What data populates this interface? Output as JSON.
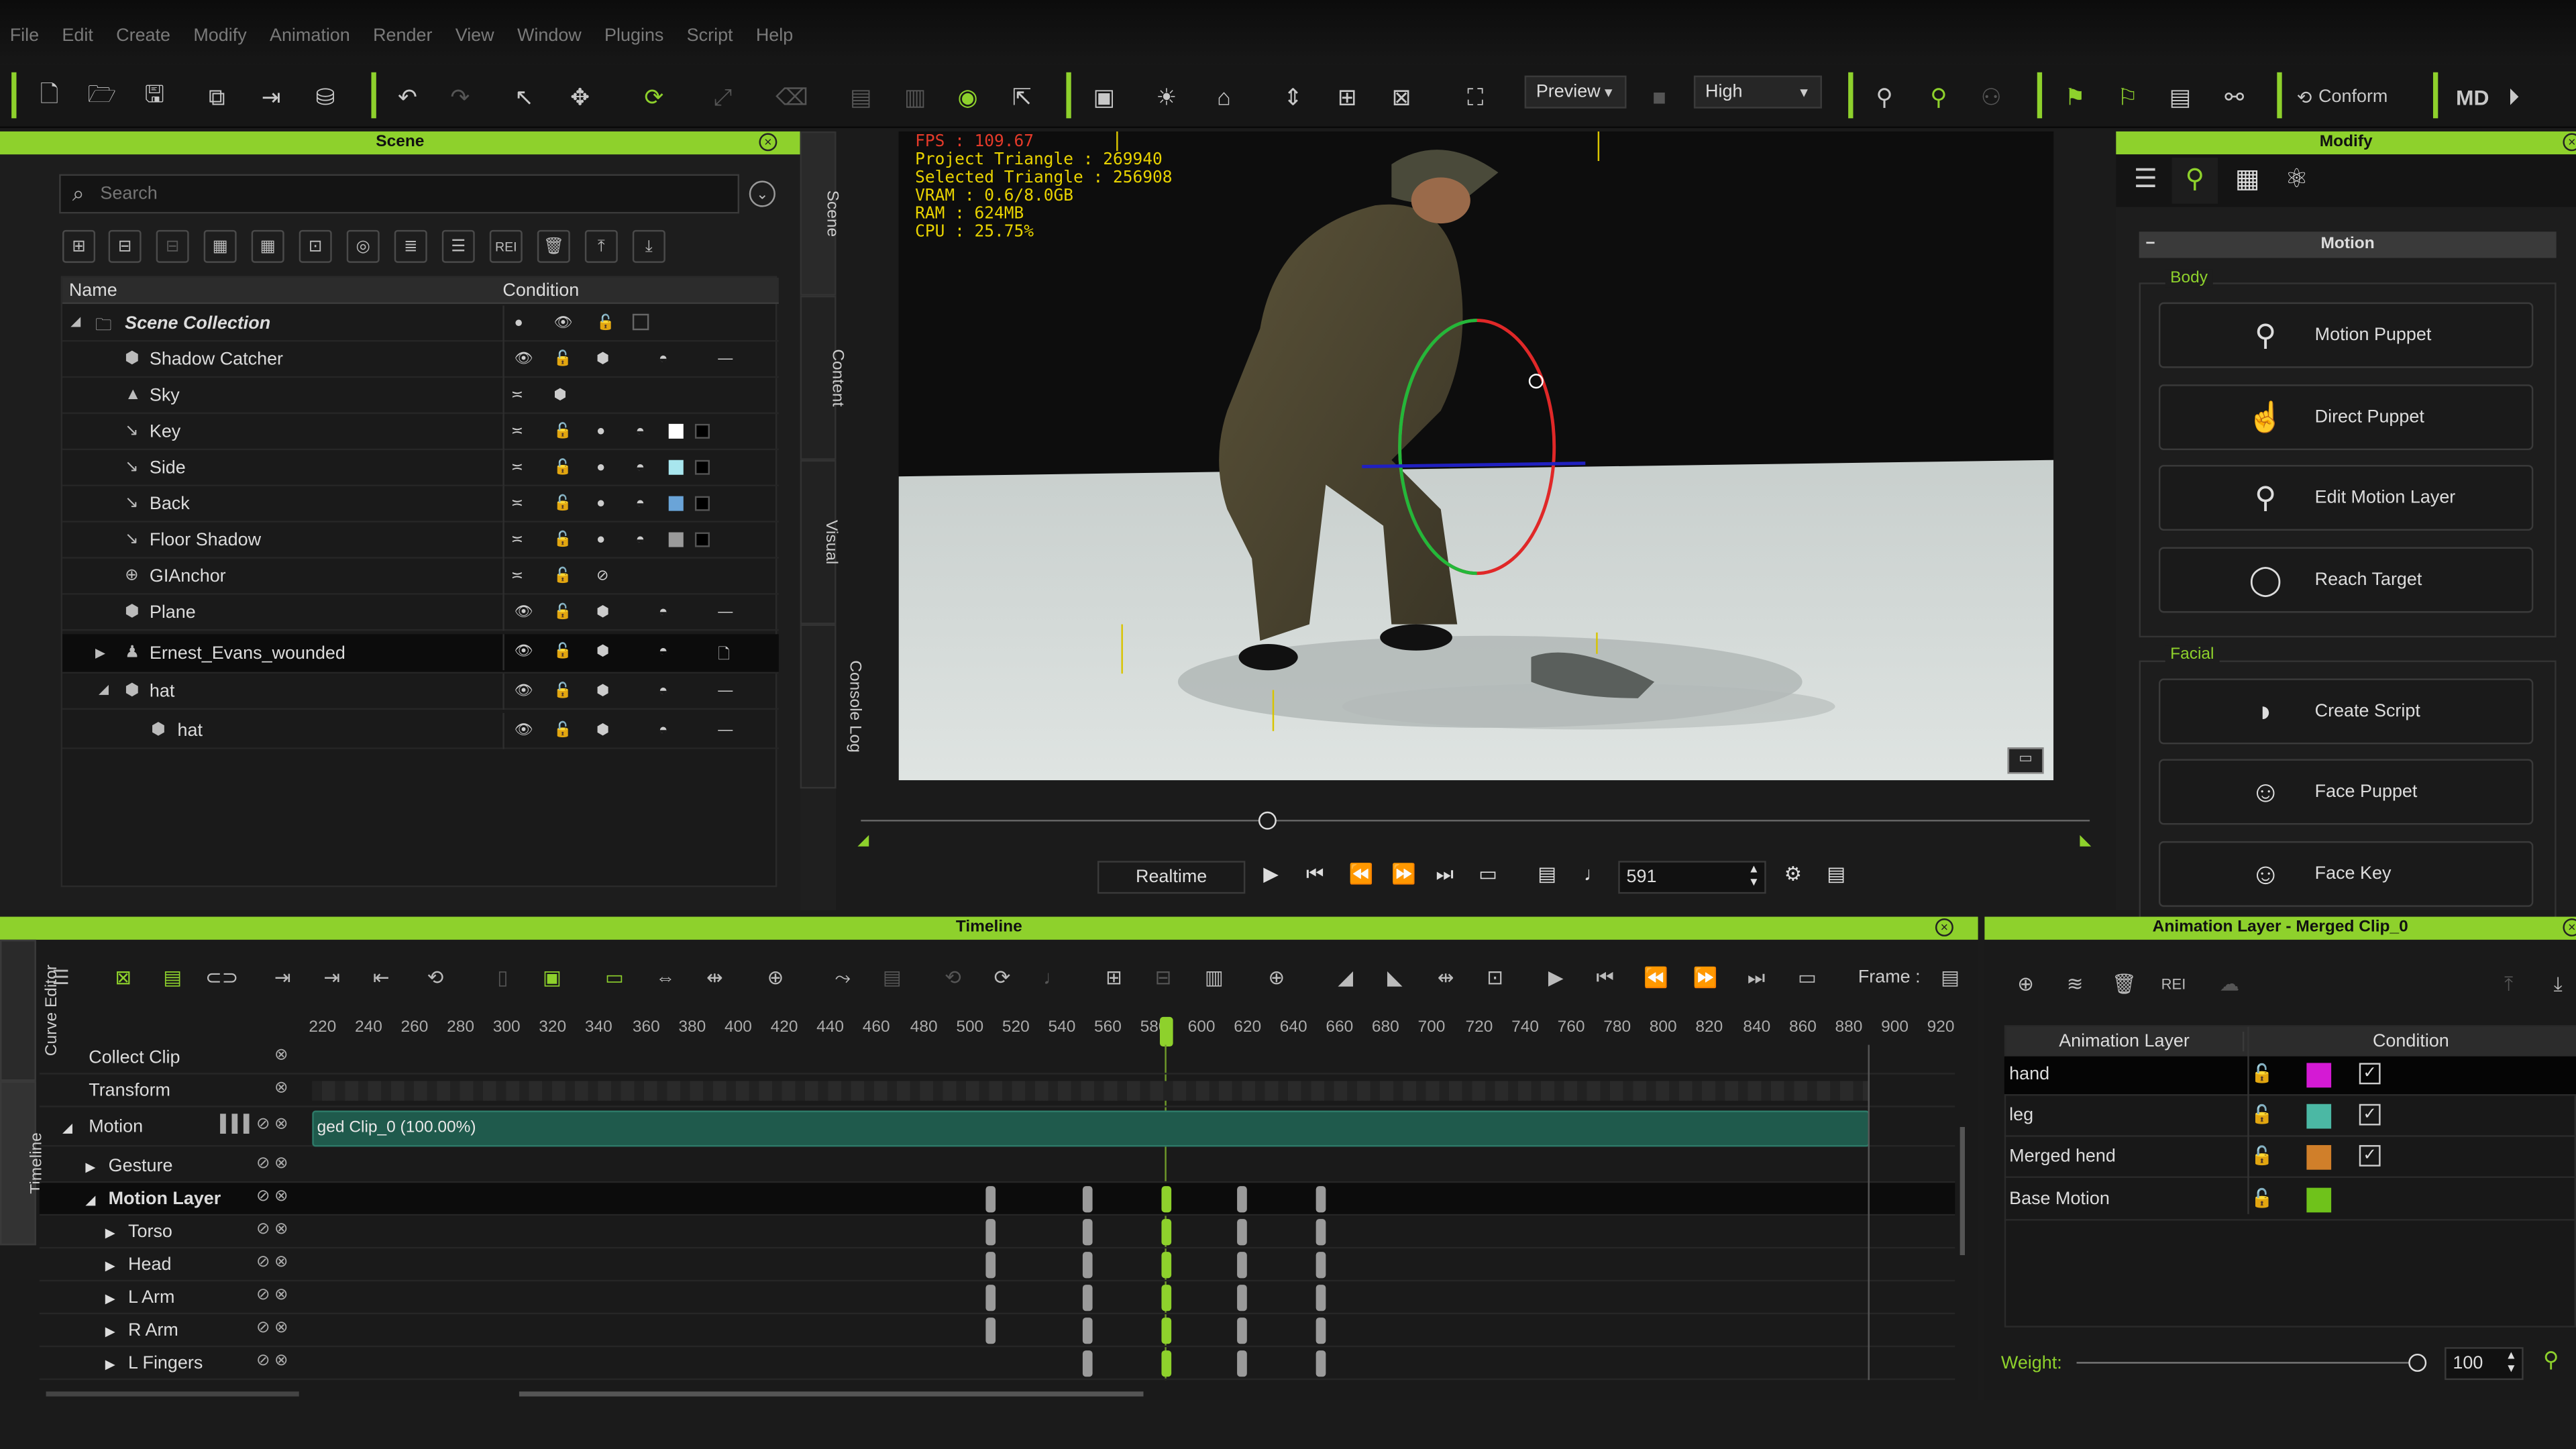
{
  "menu": [
    "File",
    "Edit",
    "Create",
    "Modify",
    "Animation",
    "Render",
    "View",
    "Window",
    "Plugins",
    "Script",
    "Help"
  ],
  "toolbar": {
    "preview_value": "Preview",
    "quality_value": "High",
    "conform_label": "Conform",
    "md_label": "MD"
  },
  "scene": {
    "title": "Scene",
    "search_placeholder": "Search",
    "col_name": "Name",
    "col_condition": "Condition",
    "tree": [
      {
        "name": "Scene Collection"
      },
      {
        "name": "Shadow Catcher"
      },
      {
        "name": "Sky"
      },
      {
        "name": "Key",
        "color": "#ffffff"
      },
      {
        "name": "Side",
        "color": "#a8e6ee"
      },
      {
        "name": "Back",
        "color": "#6aa4d8"
      },
      {
        "name": "Floor Shadow",
        "color": "#9a9a9a"
      },
      {
        "name": "GIAnchor"
      },
      {
        "name": "Plane"
      },
      {
        "name": "Ernest_Evans_wounded"
      },
      {
        "name": "hat"
      },
      {
        "name": "hat"
      }
    ]
  },
  "side_tabs": [
    "Scene",
    "Content",
    "Visual",
    "Console Log"
  ],
  "viewport": {
    "hud": [
      "FPS : 109.67",
      "Project Triangle : 269940",
      "Selected Triangle : 256908",
      "VRAM : 0.6/8.0GB",
      "RAM : 624MB",
      "CPU : 25.75%"
    ]
  },
  "playback": {
    "mode": "Realtime",
    "frame": "591"
  },
  "modify": {
    "title": "Modify",
    "section": "Motion",
    "body_label": "Body",
    "facial_label": "Facial",
    "body_buttons": [
      "Motion Puppet",
      "Direct Puppet",
      "Edit Motion Layer",
      "Reach Target"
    ],
    "facial_buttons": [
      "Create Script",
      "Face Puppet",
      "Face Key"
    ]
  },
  "timeline": {
    "title": "Timeline",
    "frame_label": "Frame :",
    "ruler": [
      "220",
      "240",
      "260",
      "280",
      "300",
      "320",
      "340",
      "360",
      "380",
      "400",
      "420",
      "440",
      "460",
      "480",
      "500",
      "520",
      "540",
      "560",
      "580",
      "600",
      "620",
      "640",
      "660",
      "680",
      "700",
      "720",
      "740",
      "760",
      "780",
      "800",
      "820",
      "840",
      "860",
      "880",
      "900",
      "920"
    ],
    "tracks": [
      "Collect Clip",
      "Transform",
      "Motion",
      "Gesture",
      "Motion Layer",
      "Torso",
      "Head",
      "L Arm",
      "R Arm",
      "L Fingers"
    ],
    "clip_label": "ged Clip_0 (100.00%)",
    "left_tabs": [
      "Curve Editor",
      "Timeline"
    ]
  },
  "anim_layer": {
    "title": "Animation Layer - Merged Clip_0",
    "col_layer": "Animation Layer",
    "col_condition": "Condition",
    "rows": [
      {
        "name": "hand",
        "color": "#d41ad4",
        "checked": "✓"
      },
      {
        "name": "leg",
        "color": "#4bb8a4",
        "checked": "✓"
      },
      {
        "name": "Merged hend",
        "color": "#d07f2a",
        "checked": "✓"
      },
      {
        "name": "Base Motion",
        "color": "#6fc21b",
        "checked": ""
      }
    ],
    "weight_label": "Weight:",
    "weight_value": "100"
  },
  "colors": {
    "accent": "#8ed12c",
    "panel": "#1d1d1d"
  }
}
